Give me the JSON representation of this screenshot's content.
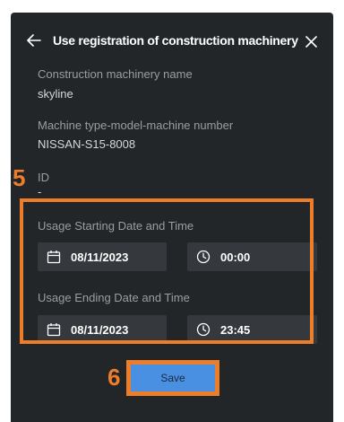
{
  "dialog": {
    "title": "Use registration of construction machinery"
  },
  "fields": {
    "machinery_name_label": "Construction machinery name",
    "machinery_name_value": "skyline",
    "machine_type_label": "Machine type-model-machine number",
    "machine_type_value": "NISSAN-S15-8008",
    "id_label": "ID",
    "id_value": "-"
  },
  "usage_start": {
    "label": "Usage Starting Date and Time",
    "date": "08/11/2023",
    "time": "00:00"
  },
  "usage_end": {
    "label": "Usage Ending Date and Time",
    "date": "08/11/2023",
    "time": "23:45"
  },
  "annotations": {
    "step_5": "5",
    "step_6": "6",
    "highlight_color": "#ee7d2a"
  },
  "actions": {
    "save_label": "Save"
  },
  "icons": {
    "back": "arrow-left-icon",
    "close": "close-icon",
    "date": "calendar-icon",
    "time": "clock-icon"
  },
  "colors": {
    "panel_bg": "#232629",
    "input_bg": "#35393d",
    "save_bg": "#4a90e2"
  }
}
